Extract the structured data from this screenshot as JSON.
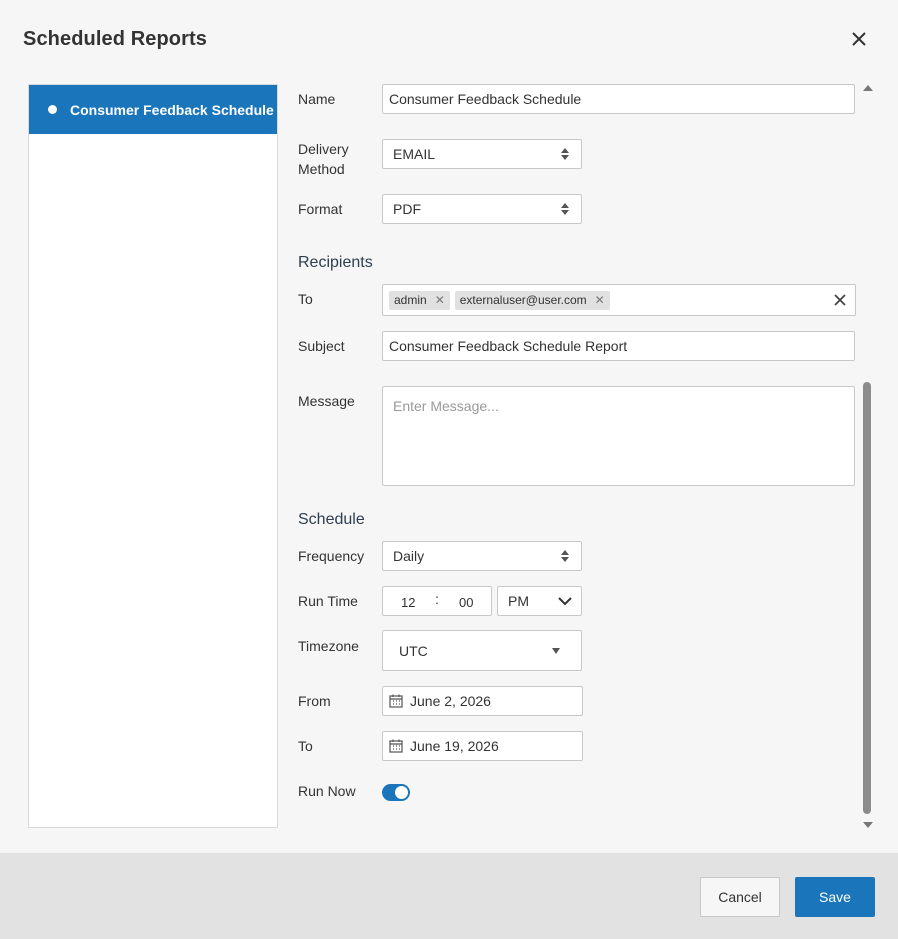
{
  "dialog": {
    "title": "Scheduled Reports"
  },
  "sidebar": {
    "items": [
      {
        "label": "Consumer Feedback Schedule"
      }
    ]
  },
  "form": {
    "name_label": "Name",
    "name_value": "Consumer Feedback Schedule",
    "delivery_label_line1": "Delivery",
    "delivery_label_line2": "Method",
    "delivery_value": "EMAIL",
    "format_label": "Format",
    "format_value": "PDF",
    "recipients_heading": "Recipients",
    "to_label": "To",
    "recipients": [
      "admin",
      "externaluser@user.com"
    ],
    "subject_label": "Subject",
    "subject_value": "Consumer Feedback Schedule Report",
    "message_label": "Message",
    "message_placeholder": "Enter Message...",
    "schedule_heading": "Schedule",
    "frequency_label": "Frequency",
    "frequency_value": "Daily",
    "runtime_label": "Run Time",
    "runtime_hour": "12",
    "runtime_sep": ":",
    "runtime_minute": "00",
    "runtime_ampm": "PM",
    "timezone_label": "Timezone",
    "timezone_value": "UTC",
    "from_label": "From",
    "from_value": "June 2, 2026",
    "to_date_label": "To",
    "to_date_value": "June 19, 2026",
    "runnow_label": "Run Now",
    "runnow_on": true
  },
  "footer": {
    "cancel_label": "Cancel",
    "save_label": "Save"
  },
  "colors": {
    "accent": "#1a75bb",
    "footer_bg": "#e2e2e2"
  }
}
